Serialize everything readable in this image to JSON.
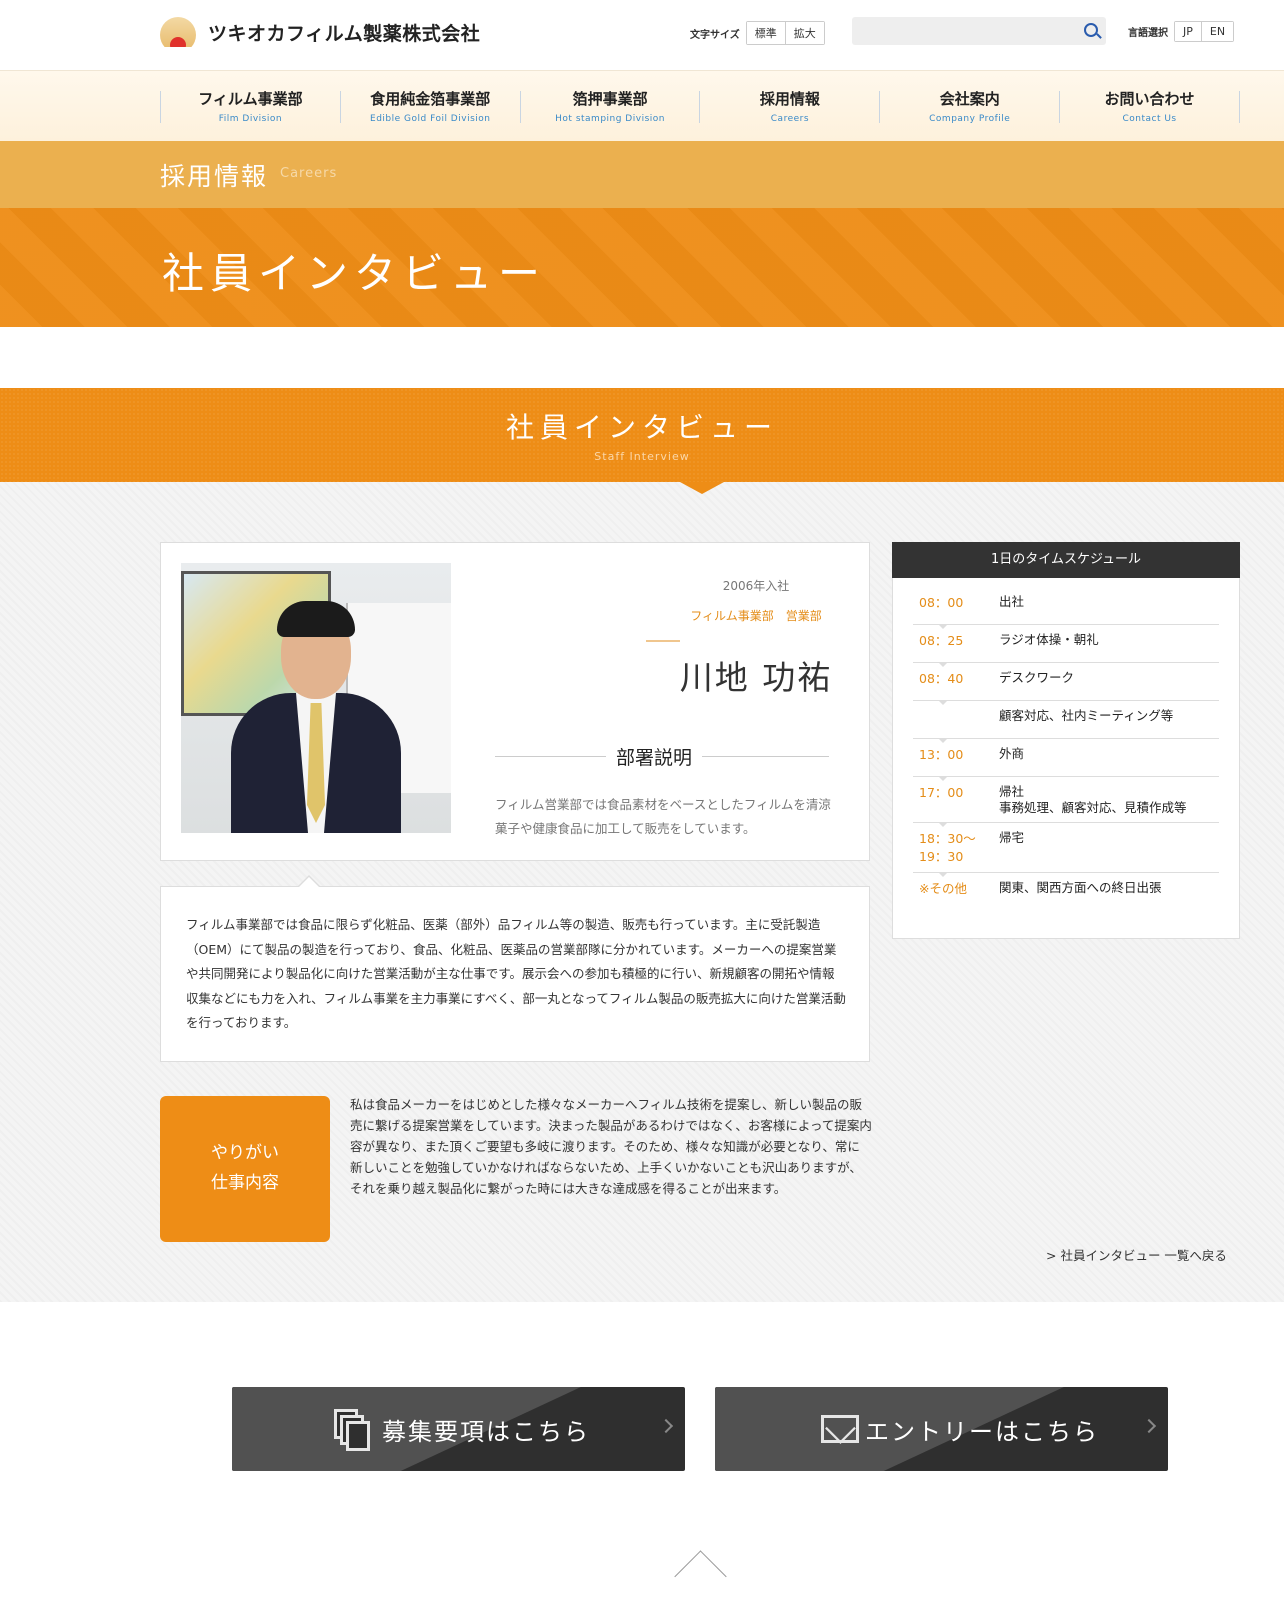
{
  "header": {
    "company_name": "ツキオカフィルム製薬株式会社",
    "font_size_label": "文字サイズ",
    "font_size_standard": "標準",
    "font_size_large": "拡大",
    "search_placeholder": "",
    "language_label": "言語選択",
    "lang_jp": "JP",
    "lang_en": "EN"
  },
  "nav": [
    {
      "jp": "フィルム事業部",
      "en": "Film Division"
    },
    {
      "jp": "食用純金箔事業部",
      "en": "Edible Gold Foil Division"
    },
    {
      "jp": "箔押事業部",
      "en": "Hot stamping Division"
    },
    {
      "jp": "採用情報",
      "en": "Careers"
    },
    {
      "jp": "会社案内",
      "en": "Company Profile"
    },
    {
      "jp": "お問い合わせ",
      "en": "Contact Us"
    }
  ],
  "category": {
    "jp": "採用情報",
    "en": "Careers"
  },
  "hero_title": "社員インタビュー",
  "section": {
    "title": "社員インタビュー",
    "subtitle": "Staff Interview"
  },
  "profile": {
    "joined": "2006年入社",
    "department": "フィルム事業部　営業部",
    "name": "川地 功祐",
    "dept_heading": "部署説明",
    "dept_text": "フィルム営業部では食品素材をベースとしたフィルムを清涼菓子や健康食品に加工して販売をしています。"
  },
  "description": "フィルム事業部では食品に限らず化粧品、医薬（部外）品フィルム等の製造、販売も行っています。主に受託製造（OEM）にて製品の製造を行っており、食品、化粧品、医薬品の営業部隊に分かれています。メーカーへの提案営業や共同開発により製品化に向けた営業活動が主な仕事です。展示会への参加も積極的に行い、新規顧客の開拓や情報収集などにも力を入れ、フィルム事業を主力事業にすべく、部一丸となってフィルム製品の販売拡大に向けた営業活動を行っております。",
  "yarigai": {
    "label_line1": "やりがい",
    "label_line2": "仕事内容",
    "text": "私は食品メーカーをはじめとした様々なメーカーへフィルム技術を提案し、新しい製品の販売に繋げる提案営業をしています。決まった製品があるわけではなく、お客様によって提案内容が異なり、また頂くご要望も多岐に渡ります。そのため、様々な知識が必要となり、常に新しいことを勉強していかなければならないため、上手くいかないことも沢山ありますが、それを乗り越え製品化に繋がった時には大きな達成感を得ることが出来ます。"
  },
  "back_link": "> 社員インタビュー 一覧へ戻る",
  "schedule": {
    "title": "1日のタイムスケジュール",
    "rows": [
      {
        "time": "08：00",
        "act": "出社"
      },
      {
        "time": "08：25",
        "act": "ラジオ体操・朝礼"
      },
      {
        "time": "08：40",
        "act": "デスクワーク"
      },
      {
        "time": "",
        "act": "顧客対応、社内ミーティング等"
      },
      {
        "time": "13：00",
        "act": "外商"
      },
      {
        "time": "17：00",
        "act": "帰社\n事務処理、顧客対応、見積作成等"
      },
      {
        "time": "18：30〜\n19：30",
        "act": "帰宅"
      },
      {
        "time": "※その他",
        "act": "関東、関西方面への終日出張"
      }
    ]
  },
  "cta": {
    "recruit": "募集要項はこちら",
    "entry": "エントリーはこちら"
  }
}
